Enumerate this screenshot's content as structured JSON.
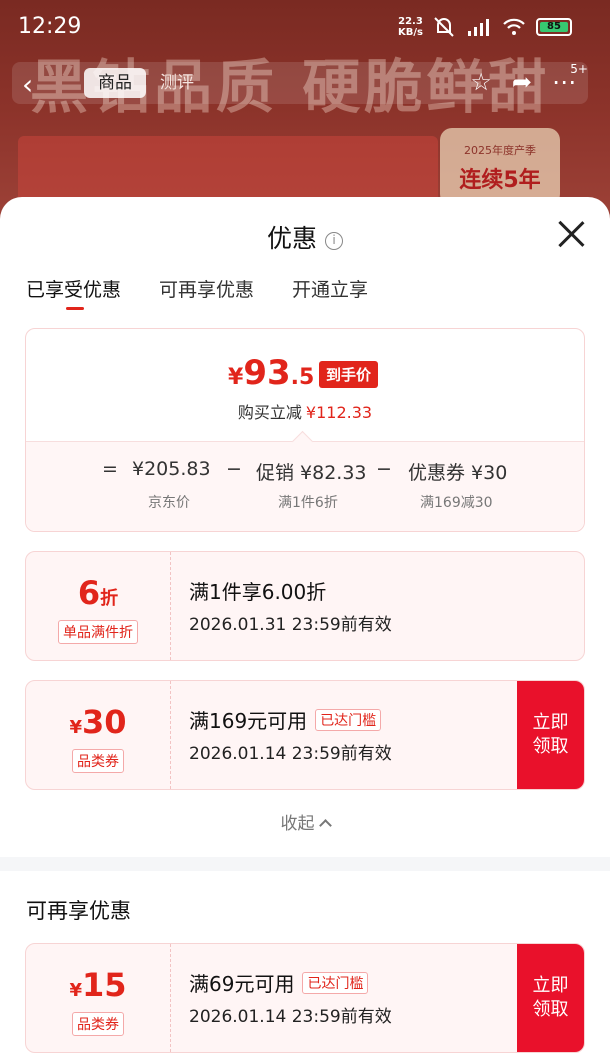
{
  "statusbar": {
    "time": "12:29",
    "speed_value": "22.3",
    "speed_unit": "KB/s",
    "battery": "85"
  },
  "background": {
    "banner": "黑钻品质 硬脆鲜甜",
    "seal_top": "2025年度产季",
    "seal_main": "连续5年"
  },
  "nav": {
    "tab_active": "商品",
    "tab_other": "测评",
    "badge": "5+"
  },
  "sheet": {
    "title": "优惠",
    "tabs": [
      "已享受优惠",
      "可再享优惠",
      "开通立享"
    ],
    "summary": {
      "currency": "¥",
      "price_int": "93",
      "price_dec": ".5",
      "deal_tag": "到手价",
      "reduce_label": "购买立减",
      "reduce_amount": "¥112.33",
      "breakdown": {
        "eq": "=",
        "base": "¥205.83",
        "minus1": "−",
        "promo": "促销 ¥82.33",
        "minus2": "−",
        "coupon": "优惠券 ¥30",
        "base_label": "京东价",
        "promo_label": "满1件6折",
        "coupon_label": "满169减30"
      }
    },
    "applied_coupons": [
      {
        "value": "6",
        "unit": "折",
        "tag": "单品满件折",
        "title": "满1件享6.00折",
        "reached": "",
        "date": "2026.01.31 23:59前有效",
        "claim": []
      },
      {
        "value": "30",
        "unit": "¥",
        "tag": "品类券",
        "title": "满169元可用",
        "reached": "已达门槛",
        "date": "2026.01.14 23:59前有效",
        "claim": [
          "立即",
          "领取"
        ]
      }
    ],
    "collapse_label": "收起",
    "more_section_title": "可再享优惠",
    "more_coupons": [
      {
        "value": "15",
        "unit": "¥",
        "tag": "品类券",
        "title": "满69元可用",
        "reached": "已达门槛",
        "date": "2026.01.14 23:59前有效",
        "claim": [
          "立即",
          "领取"
        ]
      }
    ]
  },
  "colors": {
    "accent": "#e1251b",
    "claim_bg": "#e9112b",
    "pink_border": "#f7d4d4"
  }
}
